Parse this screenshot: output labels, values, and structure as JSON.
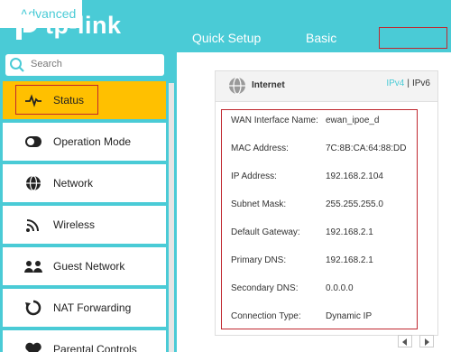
{
  "brand": {
    "name": "tp-link"
  },
  "nav": {
    "quick_setup": "Quick Setup",
    "basic": "Basic",
    "advanced": "Advanced"
  },
  "search": {
    "placeholder": "Search"
  },
  "sidebar": {
    "items": [
      {
        "label": "Status",
        "icon": "pulse-icon"
      },
      {
        "label": "Operation Mode",
        "icon": "toggle-icon"
      },
      {
        "label": "Network",
        "icon": "globe-icon"
      },
      {
        "label": "Wireless",
        "icon": "wifi-icon"
      },
      {
        "label": "Guest Network",
        "icon": "users-icon"
      },
      {
        "label": "NAT Forwarding",
        "icon": "nat-icon"
      },
      {
        "label": "Parental Controls",
        "icon": "heart-icon"
      }
    ]
  },
  "internet": {
    "title": "Internet",
    "ipv4": "IPv4",
    "separator": "|",
    "ipv6": "IPv6",
    "rows": [
      {
        "label": "WAN Interface Name:",
        "value": "ewan_ipoe_d"
      },
      {
        "label": "MAC Address:",
        "value": "7C:8B:CA:64:88:DD"
      },
      {
        "label": "IP Address:",
        "value": "192.168.2.104"
      },
      {
        "label": "Subnet Mask:",
        "value": "255.255.255.0"
      },
      {
        "label": "Default Gateway:",
        "value": "192.168.2.1"
      },
      {
        "label": "Primary DNS:",
        "value": "192.168.2.1"
      },
      {
        "label": "Secondary DNS:",
        "value": "0.0.0.0"
      },
      {
        "label": "Connection Type:",
        "value": "Dynamic IP"
      }
    ]
  },
  "colors": {
    "accent": "#4acbd6",
    "active": "#ffc000",
    "highlight": "#c0282f"
  }
}
